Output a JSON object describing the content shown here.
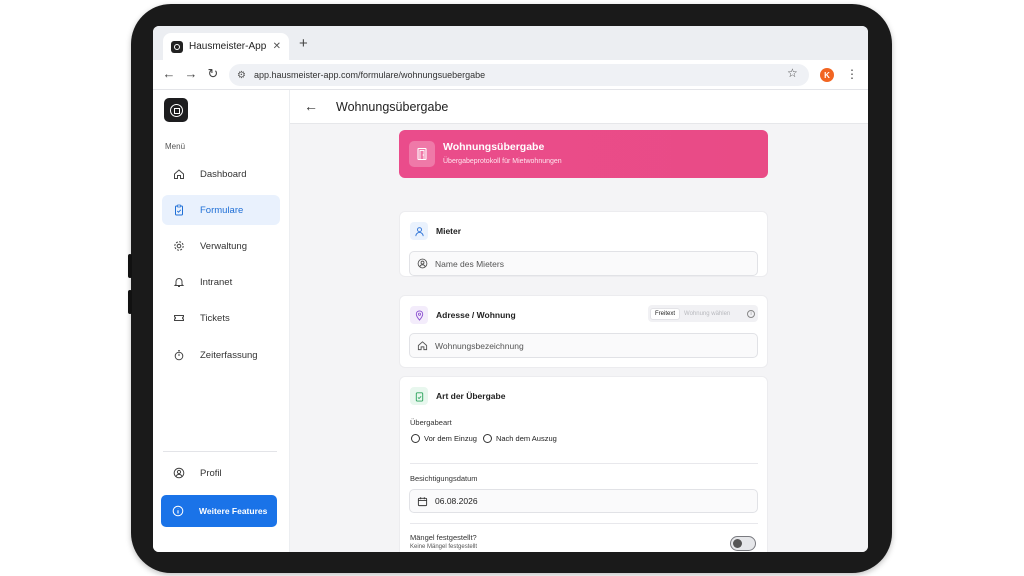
{
  "browser": {
    "tab_title": "Hausmeister-App",
    "tab_close": "✕",
    "new_tab": "+",
    "url": "app.hausmeister-app.com/formulare/wohnungsuebergabe",
    "avatar_letter": "K"
  },
  "sidebar": {
    "menu_label": "Menü",
    "items": [
      {
        "label": "Dashboard",
        "icon": "home-icon"
      },
      {
        "label": "Formulare",
        "icon": "clipboard-icon",
        "active": true
      },
      {
        "label": "Verwaltung",
        "icon": "gear-icon"
      },
      {
        "label": "Intranet",
        "icon": "bell-icon"
      },
      {
        "label": "Tickets",
        "icon": "ticket-icon"
      },
      {
        "label": "Zeiterfassung",
        "icon": "stopwatch-icon"
      }
    ],
    "profile_label": "Profil",
    "features_label": "Weitere Features"
  },
  "header": {
    "title": "Wohnungsübergabe"
  },
  "hero": {
    "title": "Wohnungsübergabe",
    "subtitle": "Übergabeprotokoll für Mietwohnungen"
  },
  "tenant": {
    "title": "Mieter",
    "placeholder": "Name des Mieters"
  },
  "address": {
    "title": "Adresse / Wohnung",
    "mode_on": "Freitext",
    "mode_off": "Wohnung wählen",
    "info": "i",
    "placeholder": "Wohnungsbezeichnung"
  },
  "handover": {
    "title": "Art der Übergabe",
    "type_label": "Übergabeart",
    "options": [
      "Vor dem Einzug",
      "Nach dem Auszug"
    ],
    "date_label": "Besichtigungsdatum",
    "date_value": "06.08.2026",
    "defects_label": "Mängel festgestellt?",
    "defects_note": "Keine Mängel festgestellt"
  },
  "colors": {
    "accent_blue": "#1a73e8",
    "hero_pink": "#ea4c8b",
    "avatar_orange": "#f26522"
  }
}
